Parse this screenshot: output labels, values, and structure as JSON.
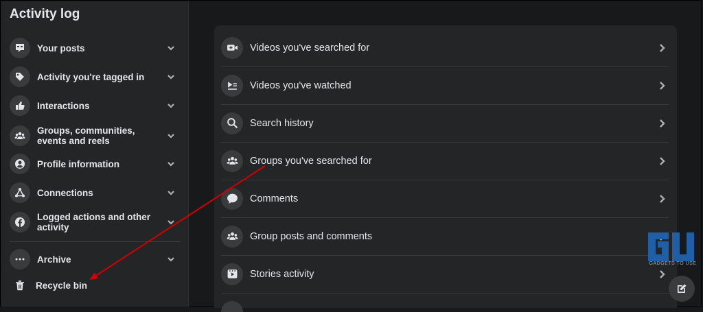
{
  "sidebar": {
    "title": "Activity log",
    "items": [
      {
        "label": "Your posts",
        "icon": "posts-icon"
      },
      {
        "label": "Activity you're tagged in",
        "icon": "tag-icon"
      },
      {
        "label": "Interactions",
        "icon": "thumbs-up-icon"
      },
      {
        "label": "Groups, communities, events and reels",
        "icon": "groups-icon"
      },
      {
        "label": "Profile information",
        "icon": "profile-icon"
      },
      {
        "label": "Connections",
        "icon": "connections-icon"
      },
      {
        "label": "Logged actions and other activity",
        "icon": "facebook-icon"
      }
    ],
    "archive": "Archive",
    "recycle_bin": "Recycle bin"
  },
  "main": {
    "rows": [
      {
        "label": "Videos you've searched for",
        "icon": "video-search-icon"
      },
      {
        "label": "Videos you've watched",
        "icon": "video-watched-icon"
      },
      {
        "label": "Search history",
        "icon": "search-icon"
      },
      {
        "label": "Groups you've searched for",
        "icon": "groups-icon"
      },
      {
        "label": "Comments",
        "icon": "comment-icon"
      },
      {
        "label": "Group posts and comments",
        "icon": "groups-icon"
      },
      {
        "label": "Stories activity",
        "icon": "stories-icon"
      }
    ]
  },
  "watermark": {
    "text": "GADGETS TO USE"
  },
  "colors": {
    "accent_arrow": "#d40000",
    "logo": "#1f5fa8",
    "background": "#18191a",
    "panel": "#242526"
  }
}
